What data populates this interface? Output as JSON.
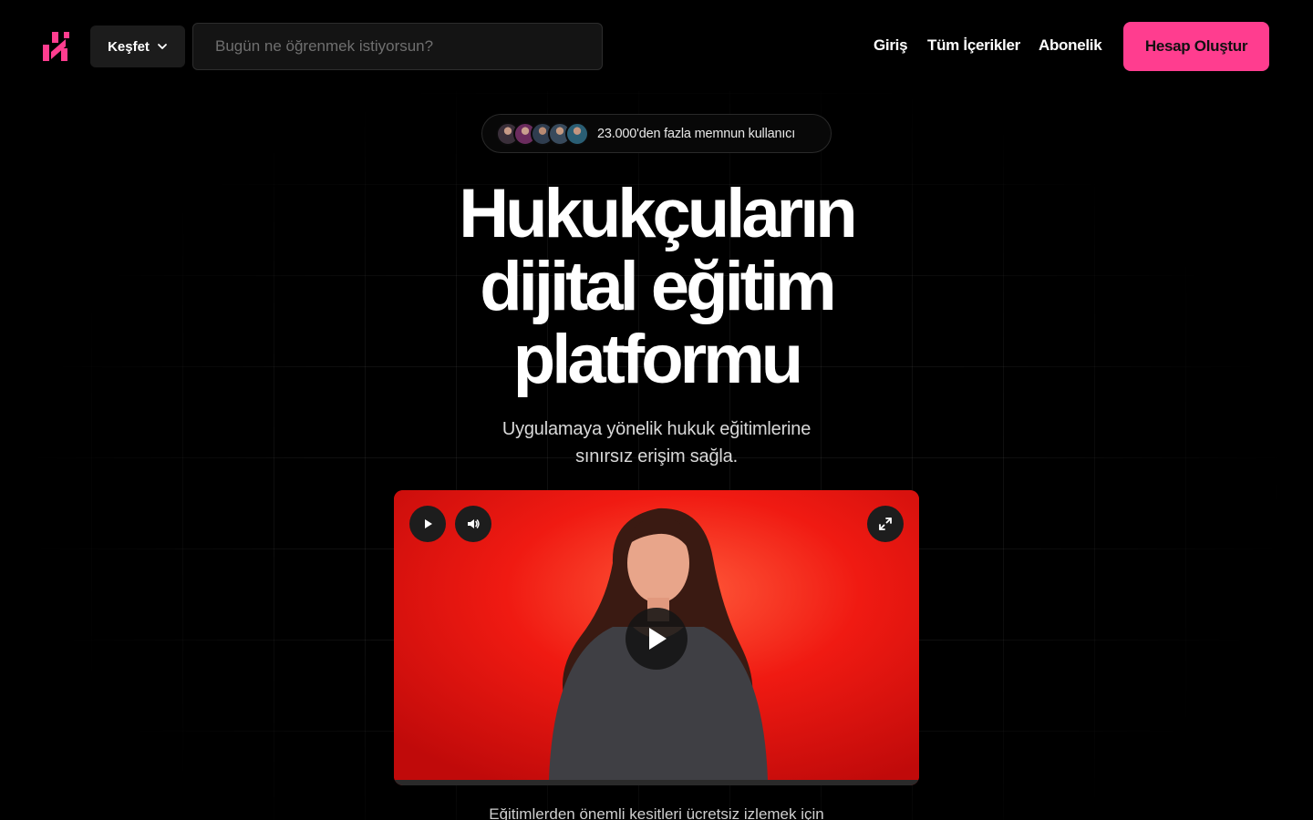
{
  "header": {
    "logo_name": "brand-logo",
    "explore_label": "Keşfet",
    "search_placeholder": "Bugün ne öğrenmek istiyorsun?",
    "nav": {
      "login": "Giriş",
      "all_content": "Tüm İçerikler",
      "subscription": "Abonelik"
    },
    "signup_label": "Hesap Oluştur"
  },
  "social_proof": {
    "text": "23.000'den fazla memnun kullanıcı",
    "avatar_count": 5
  },
  "hero": {
    "title_line1": "Hukukçuların",
    "title_line2": "dijital eğitim",
    "title_line3": "platformu",
    "subtitle_line1": "Uygulamaya yönelik hukuk eğitimlerine",
    "subtitle_line2": "sınırsız erişim sağla."
  },
  "video": {
    "controls": [
      "play-icon",
      "volume-icon",
      "fullscreen-icon"
    ],
    "center_control": "play-icon"
  },
  "footer_partial_text": "Eğitimlerden önemli kesitleri ücretsiz izlemek için",
  "colors": {
    "accent": "#ff3d8f",
    "background": "#000000",
    "video_bg": "#e81010"
  }
}
